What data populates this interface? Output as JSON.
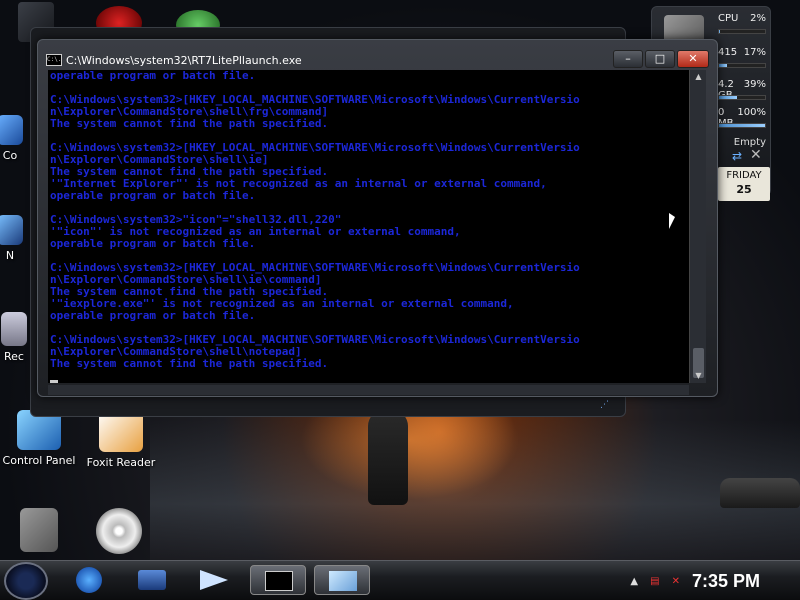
{
  "desktop": {
    "icons": [
      {
        "label": "Co"
      },
      {
        "label": "N"
      },
      {
        "label": "Rec"
      },
      {
        "label": "Control Panel"
      },
      {
        "label": "Foxit Reader"
      },
      {
        "label": ""
      },
      {
        "label": ""
      }
    ]
  },
  "gadgets": {
    "cpu_label": "CPU",
    "cpu_value": "2%",
    "cpu_level": 0.02,
    "ram_left": "415",
    "ram_right": "17%",
    "ram_level": 0.17,
    "disk_left": "4.2 GB",
    "disk_right": "39%",
    "disk_level": 0.39,
    "mem_left": "0 MB",
    "mem_right": "100%",
    "mem_level": 1.0,
    "recycle": "Empty",
    "day_name": "FRIDAY",
    "day_number": "25"
  },
  "window": {
    "title": "C:\\Windows\\system32\\RT7LitePllaunch.exe",
    "icon_text": "C:\\.",
    "minimize": "–",
    "maximize": "□",
    "close": "✕"
  },
  "console": {
    "lines": [
      "operable program or batch file.",
      "",
      "C:\\Windows\\system32>[HKEY_LOCAL_MACHINE\\SOFTWARE\\Microsoft\\Windows\\CurrentVersio",
      "n\\Explorer\\CommandStore\\shell\\frg\\command]",
      "The system cannot find the path specified.",
      "",
      "C:\\Windows\\system32>[HKEY_LOCAL_MACHINE\\SOFTWARE\\Microsoft\\Windows\\CurrentVersio",
      "n\\Explorer\\CommandStore\\shell\\ie]",
      "The system cannot find the path specified.",
      "'\"Internet Explorer\"' is not recognized as an internal or external command,",
      "operable program or batch file.",
      "",
      "C:\\Windows\\system32>\"icon\"=\"shell32.dll,220\"",
      "'\"icon\"' is not recognized as an internal or external command,",
      "operable program or batch file.",
      "",
      "C:\\Windows\\system32>[HKEY_LOCAL_MACHINE\\SOFTWARE\\Microsoft\\Windows\\CurrentVersio",
      "n\\Explorer\\CommandStore\\shell\\ie\\command]",
      "The system cannot find the path specified.",
      "'\"iexplore.exe\"' is not recognized as an internal or external command,",
      "operable program or batch file.",
      "",
      "C:\\Windows\\system32>[HKEY_LOCAL_MACHINE\\SOFTWARE\\Microsoft\\Windows\\CurrentVersio",
      "n\\Explorer\\CommandStore\\shell\\notepad]",
      "The system cannot find the path specified."
    ]
  },
  "taskbar": {
    "clock": "7:35 PM"
  },
  "colors": {
    "console_text": "#1c27d8",
    "console_bg": "#000000"
  }
}
